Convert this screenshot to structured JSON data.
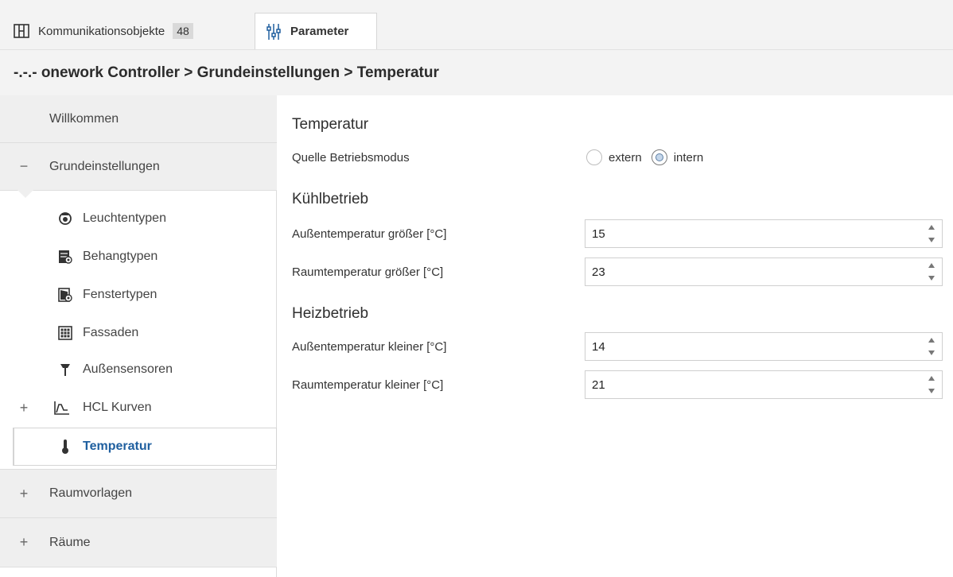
{
  "tabs": {
    "objects": {
      "label": "Kommunikationsobjekte",
      "count": "48",
      "icon": "objects-grid-icon"
    },
    "parameter": {
      "label": "Parameter",
      "icon": "sliders-icon"
    }
  },
  "breadcrumb": "-.-.- onework Controller > Grundeinstellungen > Temperatur",
  "sidebar": {
    "welcome": "Willkommen",
    "basic": {
      "prefix": "−",
      "label": "Grundeinstellungen"
    },
    "sub_items": [
      {
        "label": "Leuchtentypen",
        "icon": "lamp-icon"
      },
      {
        "label": "Behangtypen",
        "icon": "blinds-icon"
      },
      {
        "label": "Fenstertypen",
        "icon": "window-icon"
      },
      {
        "label": "Fassaden",
        "icon": "facade-grid-icon"
      },
      {
        "label": "Außensensoren",
        "icon": "outdoor-sensor-icon"
      }
    ],
    "hcl": {
      "prefix": "+",
      "label": "HCL Kurven",
      "icon": "curve-chart-icon"
    },
    "temperature": {
      "label": "Temperatur",
      "icon": "thermometer-icon"
    },
    "room_templates": {
      "prefix": "+",
      "label": "Raumvorlagen"
    },
    "rooms": {
      "prefix": "+",
      "label": "Räume"
    }
  },
  "main": {
    "title": "Temperatur",
    "mode_source": {
      "label": "Quelle Betriebsmodus",
      "options": [
        "extern",
        "intern"
      ],
      "selected": "intern"
    },
    "cooling": {
      "heading": "Kühlbetrieb",
      "outdoor_label": "Außentemperatur größer [°C]",
      "outdoor_value": "15",
      "room_label": "Raumtemperatur größer [°C]",
      "room_value": "23"
    },
    "heating": {
      "heading": "Heizbetrieb",
      "outdoor_label": "Außentemperatur kleiner [°C]",
      "outdoor_value": "14",
      "room_label": "Raumtemperatur kleiner [°C]",
      "room_value": "21"
    }
  },
  "colors": {
    "active_text": "#1f5f9f",
    "sidebar_section_bg": "#efefef",
    "header_bg": "#f3f3f3"
  }
}
